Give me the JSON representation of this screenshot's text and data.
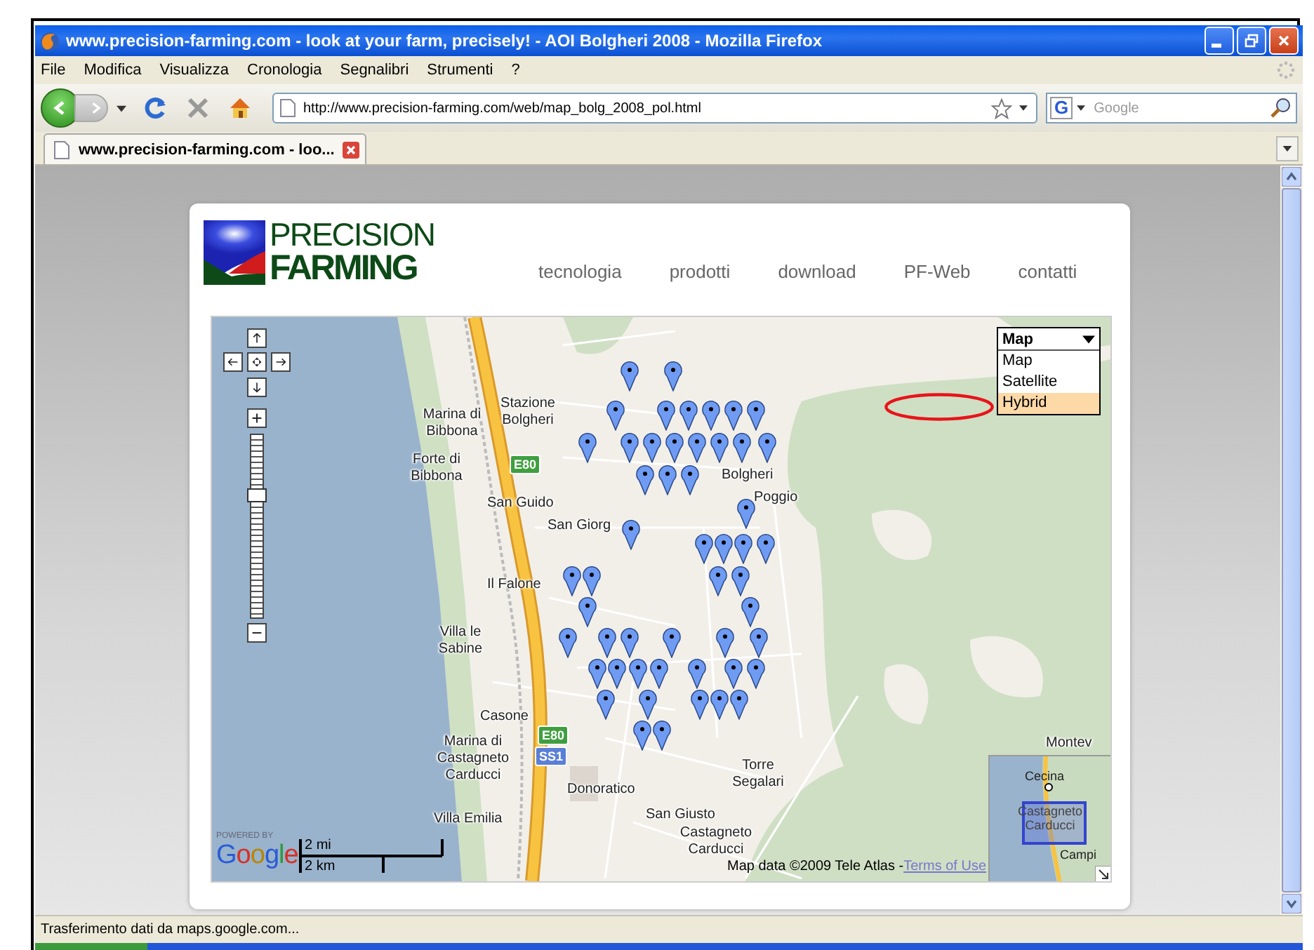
{
  "window": {
    "title": "www.precision-farming.com - look at your farm, precisely! - AOI Bolgheri 2008 - Mozilla Firefox"
  },
  "menu": [
    "File",
    "Modifica",
    "Visualizza",
    "Cronologia",
    "Segnalibri",
    "Strumenti",
    "?"
  ],
  "toolbar": {
    "url": "http://www.precision-farming.com/web/map_bolg_2008_pol.html",
    "search_engine_mark": "G",
    "search": {
      "placeholder": "Google"
    }
  },
  "tabs": [
    {
      "label": "www.precision-farming.com - loo...",
      "selected": true
    }
  ],
  "page": {
    "logo": {
      "line_1": "PRECISION",
      "line_2": "FARMING"
    },
    "nav": [
      "tecnologia",
      "prodotti",
      "download",
      "PF-Web",
      "contatti"
    ],
    "map": {
      "places": [
        "Stazione Bolgheri",
        "Marina di Bibbona",
        "Forte di Bibbona",
        "San Guido",
        "San Giorg",
        "Bolgheri",
        "Poggio",
        "Il Falone",
        "Villa le Sabine",
        "Casone",
        "Marina di Castagneto Carducci",
        "Villa Emilia",
        "Donoratico",
        "San Giusto",
        "Castagneto Carducci",
        "Torre Segalari",
        "Montev"
      ],
      "road_shields": [
        {
          "label": "E80",
          "kind": "european"
        },
        {
          "label": "E80",
          "kind": "european"
        },
        {
          "label": "SS1",
          "kind": "state"
        }
      ],
      "zoom": {
        "level": 0.69
      },
      "map_type": {
        "current": "Map",
        "options": [
          {
            "label": "Map",
            "highlighted": false
          },
          {
            "label": "Satellite",
            "highlighted": false
          },
          {
            "label": "Hybrid",
            "highlighted": true
          }
        ]
      },
      "powered_by": "POWERED BY",
      "google": "Google",
      "scale": {
        "miles": "2 mi",
        "km": "2 km"
      },
      "attribution": "Map data ©2009 Tele Atlas - ",
      "terms_link": "Terms of Use",
      "overview": {
        "places": [
          "Cecina",
          "Castagneto Carducci",
          "Campi"
        ]
      }
    }
  },
  "status_bar": "Trasferimento dati da maps.google.com..."
}
